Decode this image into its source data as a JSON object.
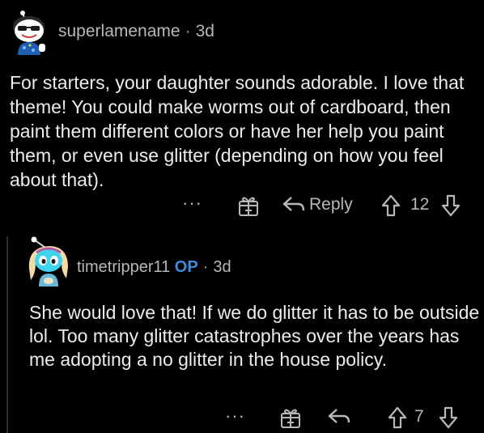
{
  "comment": {
    "author": "superlamename",
    "separator": "·",
    "age": "3d",
    "body": "For starters, your daughter sounds adorable. I love that theme! You could make worms out of cardboard, then paint them different colors or have her help you paint them, or even use glitter (depending on how you feel about that).",
    "actions": {
      "more_icon": "more-dots-icon",
      "award_icon": "gift-icon",
      "reply_icon": "reply-arrow-icon",
      "reply_label": "Reply",
      "upvote_icon": "upvote-arrow-icon",
      "score": "12",
      "downvote_icon": "downvote-arrow-icon"
    }
  },
  "reply": {
    "author": "timetripper11",
    "op_badge": "OP",
    "separator": "·",
    "age": "3d",
    "body": "She would love that! If we do glitter it has to be outside lol. Too many glitter catastrophes over the years has me adopting a no glitter in the house policy.",
    "actions": {
      "more_icon": "more-dots-icon",
      "award_icon": "gift-icon",
      "reply_icon": "reply-arrow-icon",
      "upvote_icon": "upvote-arrow-icon",
      "score": "7",
      "downvote_icon": "downvote-arrow-icon"
    }
  },
  "more_label": "···",
  "colors": {
    "background": "#000000",
    "text": "#ececec",
    "muted": "#b8b8b8",
    "op_badge": "#3d8bd9"
  }
}
